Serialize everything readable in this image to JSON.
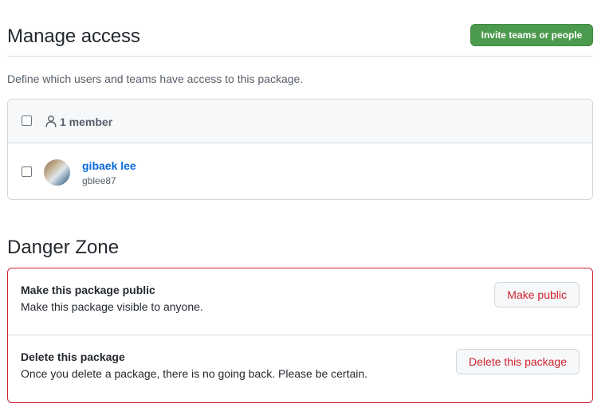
{
  "manage_access": {
    "title": "Manage access",
    "invite_button_label": "Invite teams or people",
    "description": "Define which users and teams have access to this package.",
    "members_header": {
      "count_label": "1 member",
      "icon": "person-icon"
    },
    "members": [
      {
        "name": "gibaek lee",
        "login": "gblee87",
        "avatar": "avatar"
      }
    ]
  },
  "danger_zone": {
    "title": "Danger Zone",
    "items": [
      {
        "title": "Make this package public",
        "description": "Make this package visible to anyone.",
        "button_label": "Make public"
      },
      {
        "title": "Delete this package",
        "description": "Once you delete a package, there is no going back. Please be certain.",
        "button_label": "Delete this package"
      }
    ]
  },
  "colors": {
    "primary_button": "#4c9a4d",
    "danger": "#cf222e",
    "link": "#0969da",
    "muted_text": "#57606a",
    "border": "#d0d7de"
  }
}
